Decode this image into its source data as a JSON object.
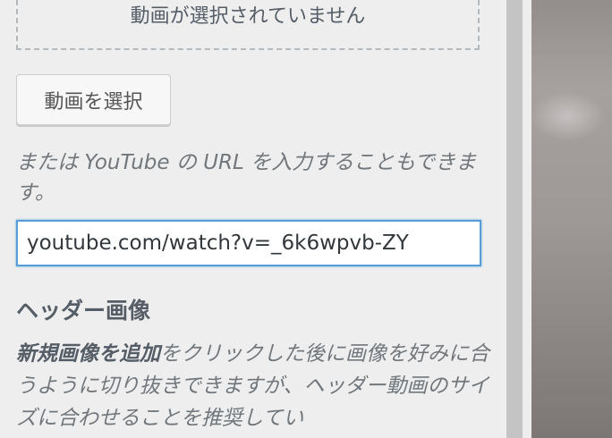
{
  "media": {
    "no_video_text": "動画が選択されていません",
    "select_button": "動画を選択",
    "description": "または YouTube の URL を入力することもできます。",
    "url_value": "youtube.com/watch?v=_6k6wpvb-ZY"
  },
  "header_image": {
    "title": "ヘッダー画像",
    "help_bold": "新規画像を追加",
    "help_text": "をクリックした後に画像を好みに合うように切り抜きできますが、ヘッダー動画のサイズに合わせることを推奨してい"
  },
  "colors": {
    "accent": "#5b9dd9",
    "panel_bg": "#eeeeee"
  }
}
